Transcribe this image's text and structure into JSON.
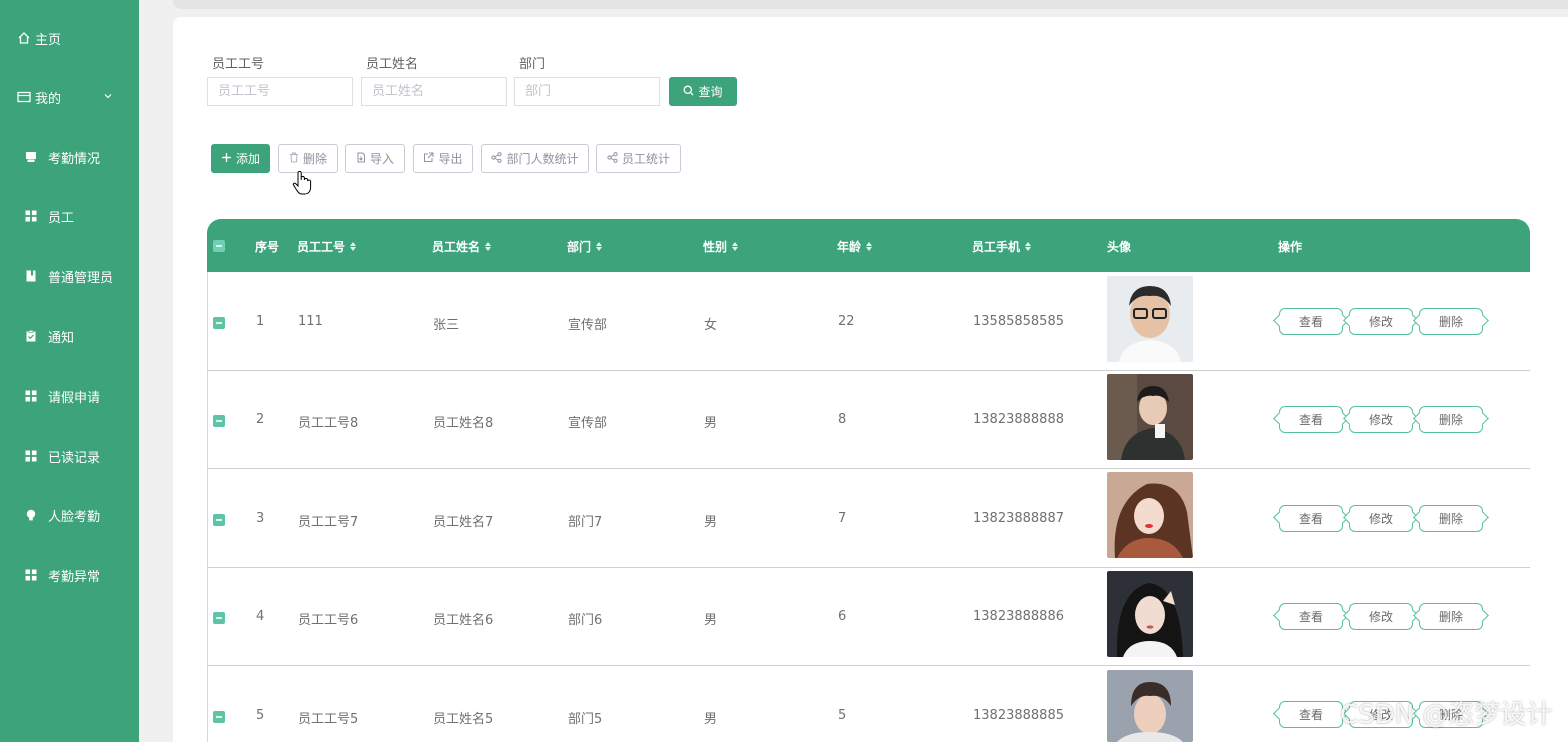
{
  "sidebar": {
    "home": "主页",
    "mine": "我的",
    "items": [
      {
        "label": "考勤情况",
        "icon": "tray-icon"
      },
      {
        "label": "员工",
        "icon": "grid-icon"
      },
      {
        "label": "普通管理员",
        "icon": "book-icon"
      },
      {
        "label": "通知",
        "icon": "clipboard-icon"
      },
      {
        "label": "请假申请",
        "icon": "grid-icon"
      },
      {
        "label": "已读记录",
        "icon": "grid-icon"
      },
      {
        "label": "人脸考勤",
        "icon": "bulb-icon"
      },
      {
        "label": "考勤异常",
        "icon": "grid-icon"
      }
    ]
  },
  "search": {
    "fields": [
      {
        "label": "员工工号",
        "placeholder": "员工工号"
      },
      {
        "label": "员工姓名",
        "placeholder": "员工姓名"
      },
      {
        "label": "部门",
        "placeholder": "部门"
      }
    ],
    "query_label": "查询"
  },
  "toolbar": {
    "add": "添加",
    "delete": "删除",
    "import": "导入",
    "export": "导出",
    "dept_stats": "部门人数统计",
    "staff_stats": "员工统计"
  },
  "table": {
    "headers": [
      "序号",
      "员工工号",
      "员工姓名",
      "部门",
      "性别",
      "年龄",
      "员工手机",
      "头像",
      "操作"
    ],
    "rows": [
      {
        "no": "1",
        "id": "111",
        "name": "张三",
        "dept": "宣传部",
        "gender": "女",
        "age": "22",
        "phone": "13585858585",
        "avatar_bg": "#e9ecee",
        "avatar_fg": "#2b2b2b"
      },
      {
        "no": "2",
        "id": "员工工号8",
        "name": "员工姓名8",
        "dept": "宣传部",
        "gender": "男",
        "age": "8",
        "phone": "13823888888",
        "avatar_bg": "#5b4a40",
        "avatar_fg": "#1c1c1c"
      },
      {
        "no": "3",
        "id": "员工工号7",
        "name": "员工姓名7",
        "dept": "部门7",
        "gender": "男",
        "age": "7",
        "phone": "13823888887",
        "avatar_bg": "#caa896",
        "avatar_fg": "#5b3424"
      },
      {
        "no": "4",
        "id": "员工工号6",
        "name": "员工姓名6",
        "dept": "部门6",
        "gender": "男",
        "age": "6",
        "phone": "13823888886",
        "avatar_bg": "#2e3038",
        "avatar_fg": "#f1dcd2"
      },
      {
        "no": "5",
        "id": "员工工号5",
        "name": "员工姓名5",
        "dept": "部门5",
        "gender": "男",
        "age": "5",
        "phone": "13823888885",
        "avatar_bg": "#9aa2ad",
        "avatar_fg": "#3a2c28"
      }
    ],
    "ops": [
      "查看",
      "修改",
      "删除"
    ]
  },
  "watermark": "CSDN @恣梦设计",
  "colors": {
    "primary": "#3ca37b",
    "op_border": "#54c0a0"
  }
}
